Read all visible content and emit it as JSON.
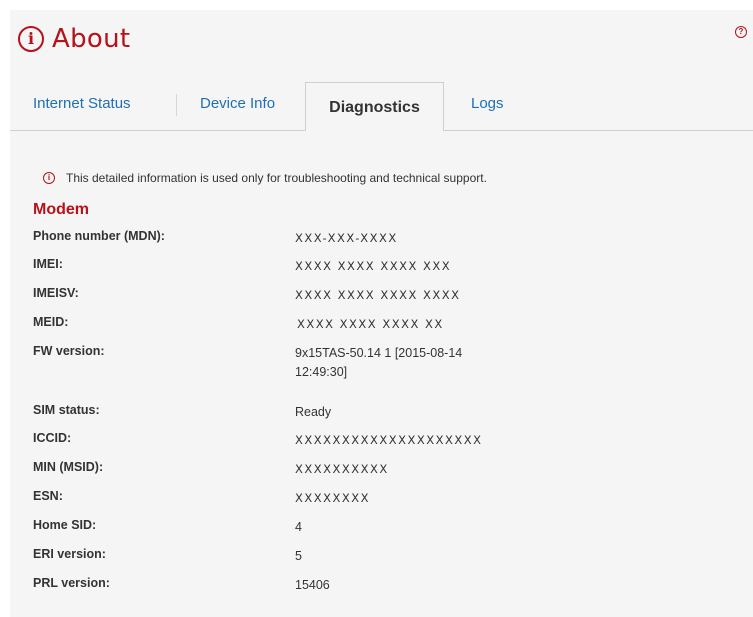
{
  "page": {
    "title": "About",
    "help_icon": "question-mark-icon",
    "title_icon": "info-icon"
  },
  "tabs": [
    {
      "label": "Internet Status",
      "active": false
    },
    {
      "label": "Device Info",
      "active": false
    },
    {
      "label": "Diagnostics",
      "active": true
    },
    {
      "label": "Logs",
      "active": false
    }
  ],
  "notice": "This detailed information is used only for troubleshooting and technical support.",
  "section": {
    "title": "Modem"
  },
  "rows": [
    {
      "label": "Phone number (MDN):",
      "value": "XXX-XXX-XXXX"
    },
    {
      "label": "IMEI:",
      "value": "XXXX XXXX XXXX XXX"
    },
    {
      "label": "IMEISV:",
      "value": "XXXX XXXX XXXX XXXX"
    },
    {
      "label": "MEID:",
      "value": "XXXX XXXX XXXX XX"
    },
    {
      "label": "FW version:",
      "value": "9x15TAS-50.14 1 [2015-08-14",
      "value2": "12:49:30]"
    },
    {
      "label": "SIM status:",
      "value": "Ready"
    },
    {
      "label": "ICCID:",
      "value": "XXXXXXXXXXXXXXXXXXXX"
    },
    {
      "label": "MIN (MSID):",
      "value": "XXXXXXXXXX"
    },
    {
      "label": "ESN:",
      "value": "XXXXXXXX"
    },
    {
      "label": "Home SID:",
      "value": "4"
    },
    {
      "label": "ERI version:",
      "value": "5"
    },
    {
      "label": "PRL version:",
      "value": "15406"
    }
  ],
  "colors": {
    "accent": "#b5121b",
    "link": "#1f6fb5",
    "panel": "#f5f5f5"
  }
}
